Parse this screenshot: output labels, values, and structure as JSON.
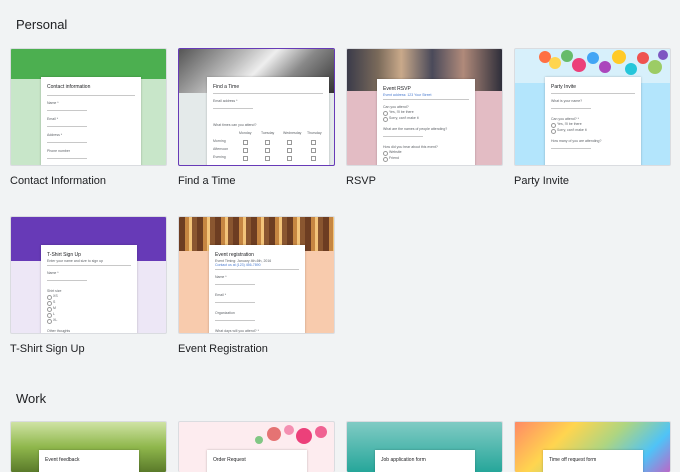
{
  "sections": {
    "personal": "Personal",
    "work": "Work"
  },
  "templates": {
    "personal": [
      {
        "label": "Contact Information",
        "form_title": "Contact information",
        "theme": "#4caf50"
      },
      {
        "label": "Find a Time",
        "form_title": "Find a Time",
        "theme": "#673ab7"
      },
      {
        "label": "RSVP",
        "form_title": "Event RSVP",
        "theme": "#e6b8c0"
      },
      {
        "label": "Party Invite",
        "form_title": "Party Invite",
        "theme": "#b3e5fc"
      },
      {
        "label": "T-Shirt Sign Up",
        "form_title": "T-Shirt Sign Up",
        "theme": "#673ab7"
      },
      {
        "label": "Event Registration",
        "form_title": "Event registration",
        "theme": "#f8cbad"
      }
    ],
    "work": [
      {
        "form_title": "Event feedback"
      },
      {
        "form_title": "Order Request"
      },
      {
        "form_title": "Job application form"
      },
      {
        "form_title": "Time off request form"
      }
    ]
  }
}
